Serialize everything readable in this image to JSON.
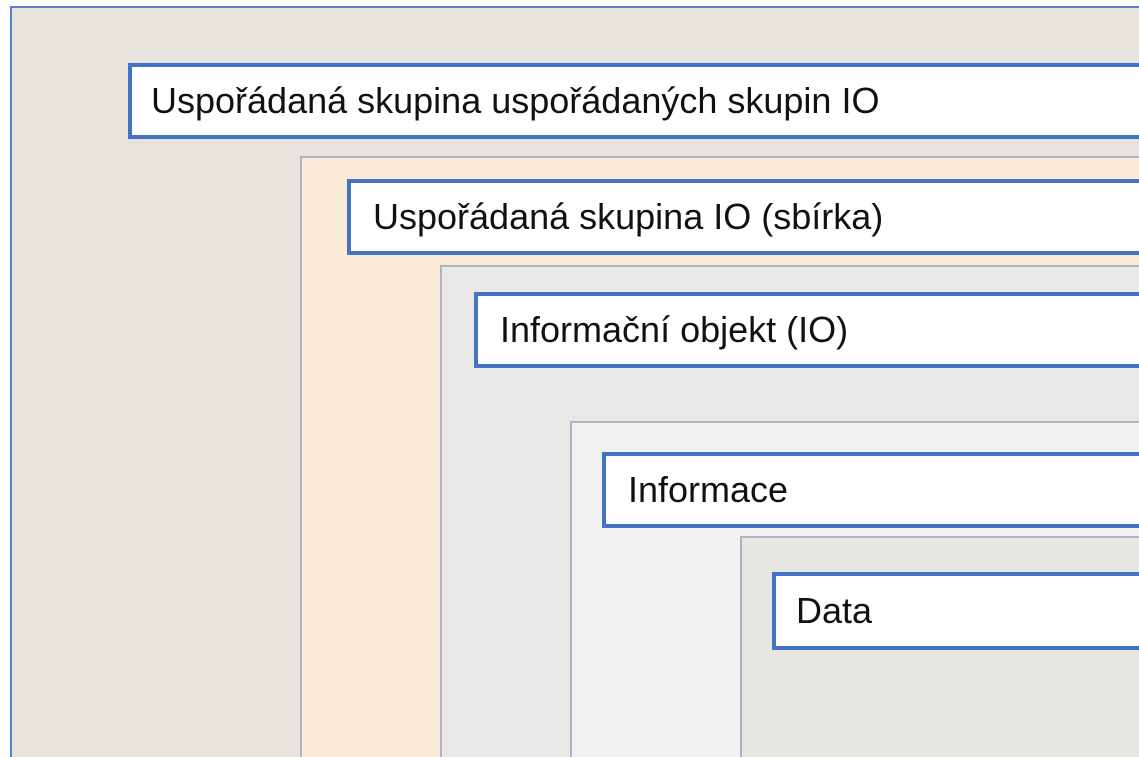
{
  "layers": [
    {
      "label": "Uspořádaná skupina uspořádaných skupin IO",
      "fill": "#e8e2dc"
    },
    {
      "label": "Uspořádaná skupina IO (sbírka)",
      "fill": "#faebd6"
    },
    {
      "label": "Informační objekt (IO)",
      "fill": "#e9e8e7"
    },
    {
      "label": "Informace",
      "fill": "#f2f2f2"
    },
    {
      "label": "Data",
      "fill": "#e7e7e2"
    }
  ],
  "colors": {
    "label_border": "#4472c4",
    "layer_border": "#aab4c6",
    "outer_border": "#5b7fc4"
  }
}
